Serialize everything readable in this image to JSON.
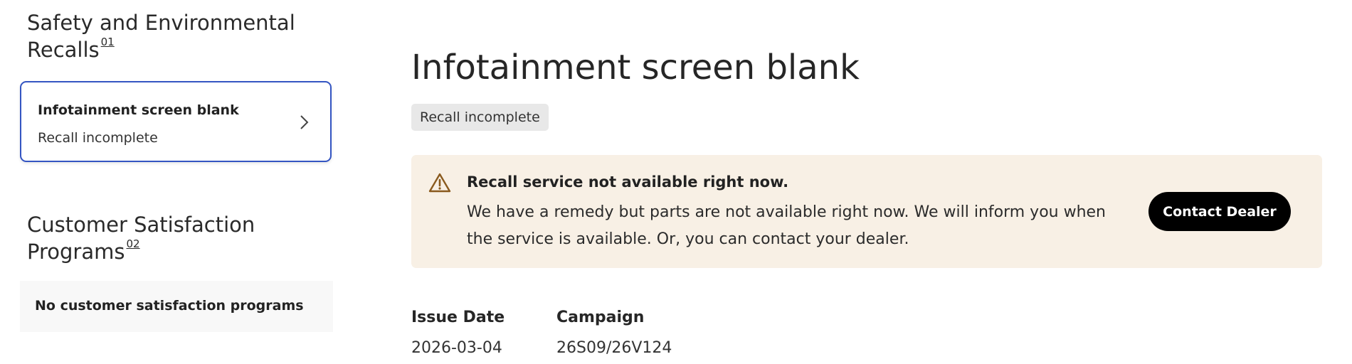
{
  "sidebar": {
    "recalls_section": {
      "title": "Safety and Environmental Recalls",
      "footnote": "01"
    },
    "recall_items": [
      {
        "title": "Infotainment screen blank",
        "status": "Recall incomplete",
        "selected": true
      }
    ],
    "programs_section": {
      "title": "Customer Satisfaction Programs",
      "footnote": "02",
      "empty_message": "No customer satisfaction programs"
    }
  },
  "main": {
    "title": "Infotainment screen blank",
    "status_badge": "Recall incomplete",
    "alert": {
      "icon": "warning-triangle-icon",
      "heading": "Recall service not available right now.",
      "body": "We have a remedy but parts are not available right now. We will inform you when the service is available. Or, you can contact your dealer.",
      "button_label": "Contact Dealer"
    },
    "details": [
      {
        "label": "Issue Date",
        "value": "2026-03-04"
      },
      {
        "label": "Campaign",
        "value": "26S09/26V124"
      }
    ]
  },
  "colors": {
    "card_border": "#3455c2",
    "alert_background": "#f8f0e5",
    "warning_icon": "#8a5a1e",
    "badge_background": "#e8e8e8",
    "button_background": "#000000"
  }
}
